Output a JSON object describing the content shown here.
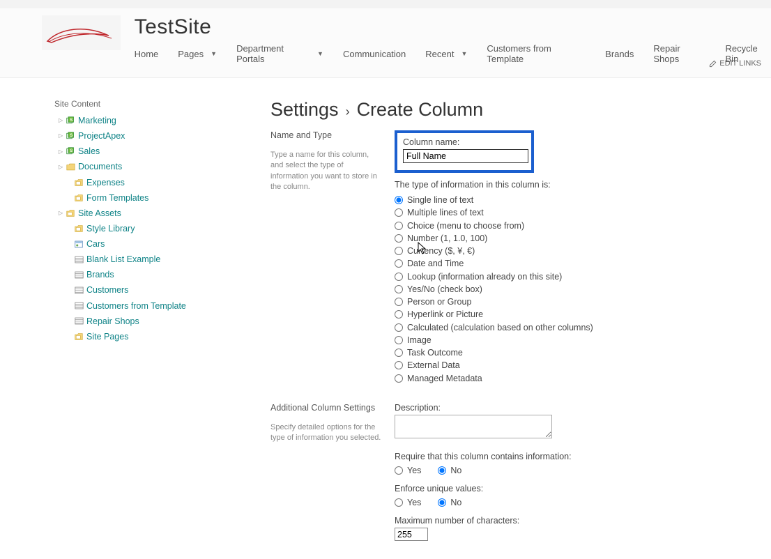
{
  "site": {
    "title": "TestSite"
  },
  "nav": {
    "items": [
      {
        "label": "Home",
        "caret": false
      },
      {
        "label": "Pages",
        "caret": true
      },
      {
        "label": "Department Portals",
        "caret": true
      },
      {
        "label": "Communication",
        "caret": false
      },
      {
        "label": "Recent",
        "caret": true
      },
      {
        "label": "Customers from Template",
        "caret": false
      },
      {
        "label": "Brands",
        "caret": false
      },
      {
        "label": "Repair Shops",
        "caret": false
      },
      {
        "label": "Recycle Bin",
        "caret": false
      }
    ],
    "edit_links": "EDIT LINKS"
  },
  "sidebar": {
    "heading": "Site Content",
    "items": [
      {
        "label": "Marketing",
        "icon": "share",
        "indent": 1,
        "caret": true
      },
      {
        "label": "ProjectApex",
        "icon": "share",
        "indent": 1,
        "caret": true
      },
      {
        "label": "Sales",
        "icon": "share",
        "indent": 1,
        "caret": true
      },
      {
        "label": "Documents",
        "icon": "folder",
        "indent": 1,
        "caret": true
      },
      {
        "label": "Expenses",
        "icon": "library",
        "indent": 2,
        "caret": false
      },
      {
        "label": "Form Templates",
        "icon": "library",
        "indent": 2,
        "caret": false
      },
      {
        "label": "Site Assets",
        "icon": "library",
        "indent": 1,
        "caret": true
      },
      {
        "label": "Style Library",
        "icon": "library",
        "indent": 2,
        "caret": false
      },
      {
        "label": "Cars",
        "icon": "listpic",
        "indent": 2,
        "caret": false
      },
      {
        "label": "Blank List Example",
        "icon": "list",
        "indent": 2,
        "caret": false
      },
      {
        "label": "Brands",
        "icon": "list",
        "indent": 2,
        "caret": false
      },
      {
        "label": "Customers",
        "icon": "list",
        "indent": 2,
        "caret": false
      },
      {
        "label": "Customers from Template",
        "icon": "list",
        "indent": 2,
        "caret": false
      },
      {
        "label": "Repair Shops",
        "icon": "list",
        "indent": 2,
        "caret": false
      },
      {
        "label": "Site Pages",
        "icon": "library",
        "indent": 2,
        "caret": false
      }
    ]
  },
  "page": {
    "crumb1": "Settings",
    "crumb2": "Create Column"
  },
  "name_type": {
    "heading": "Name and Type",
    "description": "Type a name for this column, and select the type of information you want to store in the column.",
    "column_name_label": "Column name:",
    "column_name_value": "Full Name",
    "type_label": "The type of information in this column is:",
    "options": [
      "Single line of text",
      "Multiple lines of text",
      "Choice (menu to choose from)",
      "Number (1, 1.0, 100)",
      "Currency ($, ¥, €)",
      "Date and Time",
      "Lookup (information already on this site)",
      "Yes/No (check box)",
      "Person or Group",
      "Hyperlink or Picture",
      "Calculated (calculation based on other columns)",
      "Image",
      "Task Outcome",
      "External Data",
      "Managed Metadata"
    ],
    "selected_index": 0
  },
  "additional": {
    "heading": "Additional Column Settings",
    "description": "Specify detailed options for the type of information you selected.",
    "description_label": "Description:",
    "require_label": "Require that this column contains information:",
    "yes": "Yes",
    "no": "No",
    "enforce_label": "Enforce unique values:",
    "max_chars_label": "Maximum number of characters:",
    "max_chars_value": "255"
  }
}
